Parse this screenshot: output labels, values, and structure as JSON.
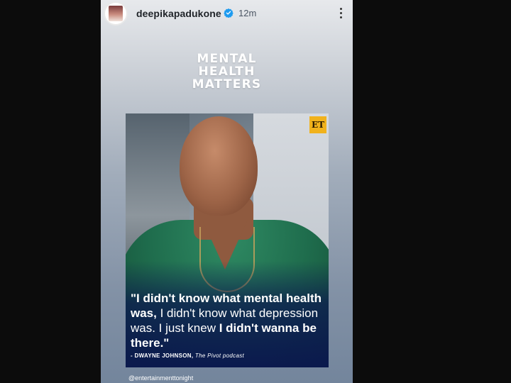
{
  "story": {
    "username": "deepikapadukone",
    "time": "12m",
    "headline_lines": [
      "MENTAL",
      "HEALTH",
      "MATTERS"
    ],
    "post": {
      "badge": "ET",
      "quote_bold_1": "\"I didn't know what mental health was,",
      "quote_normal_1": " I didn't know what depression was. I just knew ",
      "quote_bold_2": "I didn't wanna be there.\"",
      "attribution_name": "- DWAYNE JOHNSON,",
      "attribution_source": " The Pivot podcast"
    },
    "mention": "@entertainmenttonight"
  },
  "icons": {
    "verified": "verified-badge-icon",
    "more": "more-vertical-icon"
  },
  "colors": {
    "verified_blue": "#1d9bf0",
    "badge_yellow": "#f1b21c"
  }
}
